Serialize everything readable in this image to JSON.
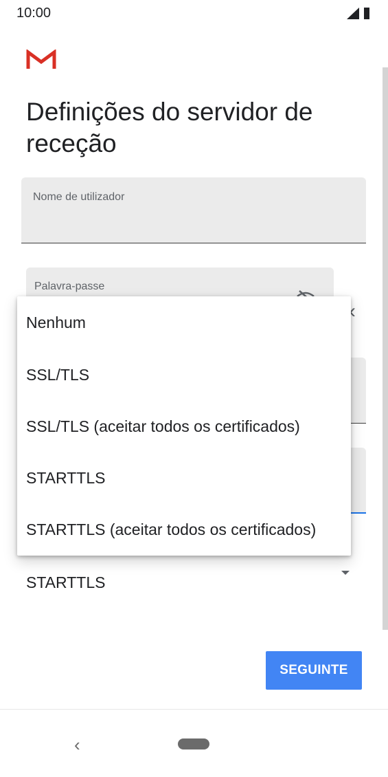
{
  "status_bar": {
    "time": "10:00",
    "icons": [
      "signal-icon",
      "battery-icon"
    ]
  },
  "app": {
    "logo": "gmail-icon"
  },
  "page": {
    "title": "Definições do servidor de receção"
  },
  "fields": {
    "username": {
      "label": "Nome de utilizador",
      "value": ""
    },
    "password": {
      "label": "Palavra-passe",
      "value": "",
      "toggle_icon": "visibility-off-icon"
    }
  },
  "security_dropdown": {
    "options": [
      "Nenhum",
      "SSL/TLS",
      "SSL/TLS (aceitar todos os certificados)",
      "STARTTLS",
      "STARTTLS (aceitar todos os certificados)"
    ],
    "selected": "STARTTLS"
  },
  "actions": {
    "next_label": "SEGUINTE"
  },
  "nav_bar": {
    "back_icon": "back-icon",
    "home_icon": "home-pill-icon"
  },
  "colors": {
    "accent": "#4285f4",
    "field_bg": "#ebebeb",
    "focus_underline": "#1a73e8"
  }
}
